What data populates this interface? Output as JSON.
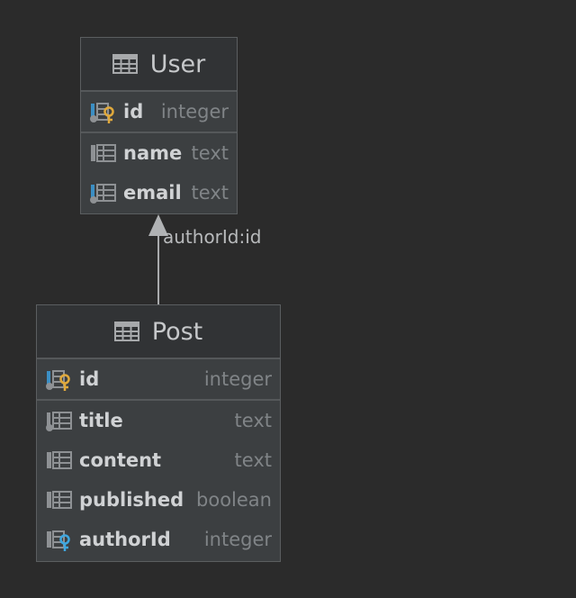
{
  "tables": {
    "user": {
      "name": "User",
      "pk": {
        "name": "id",
        "type": "integer"
      },
      "columns": [
        {
          "name": "name",
          "type": "text"
        },
        {
          "name": "email",
          "type": "text"
        }
      ]
    },
    "post": {
      "name": "Post",
      "pk": {
        "name": "id",
        "type": "integer"
      },
      "columns": [
        {
          "name": "title",
          "type": "text"
        },
        {
          "name": "content",
          "type": "text"
        },
        {
          "name": "published",
          "type": "boolean"
        },
        {
          "name": "authorId",
          "type": "integer"
        }
      ]
    }
  },
  "relation": {
    "label": "authorId:id"
  },
  "colors": {
    "background": "#2b2b2b",
    "table_body": "#3c3f41",
    "key_gold": "#e0a93c",
    "fk_blue": "#3fa7df",
    "column_gray": "#8e9194"
  }
}
